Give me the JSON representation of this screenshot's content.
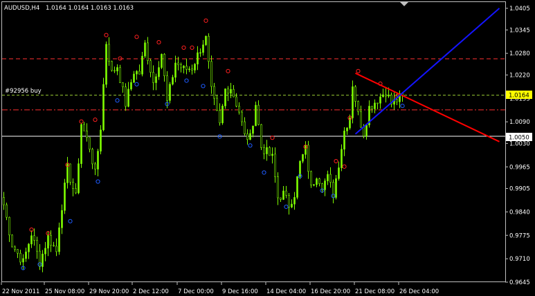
{
  "window": {
    "symbol_label": "AUDUSD,H4",
    "ohlc_label": "1.0164 1.0164 1.0163 1.0163"
  },
  "order": {
    "label": "#92956 buy",
    "price": 1.0125
  },
  "colors": {
    "background": "#000000",
    "frame": "#c0c0c0",
    "bull_candle": "#7fff00",
    "bear_candle": "#7fff00",
    "fractal_up": "#ff2020",
    "fractal_down": "#1e5cff",
    "order_line": "#9acd32",
    "sl_line": "#ff3030",
    "resistance_line": "#ff0000",
    "support_line": "#1414ff",
    "bid_badge": "#ffff00",
    "stop_badge": "#ffffff"
  },
  "chart_data": {
    "type": "candlestick",
    "title": "AUDUSD,H4",
    "y_ticks": [
      "1.0405",
      "1.0345",
      "1.0280",
      "1.0220",
      "1.0155",
      "1.0090",
      "1.0030",
      "0.9965",
      "0.9905",
      "0.9840",
      "0.9775",
      "0.9710",
      "0.9645"
    ],
    "ylim": [
      0.9645,
      1.0405
    ],
    "x_ticks": [
      "22 Nov 2011",
      "25 Nov 08:00",
      "29 Nov 20:00",
      "2 Dec 12:00",
      "7 Dec 00:00",
      "9 Dec 16:00",
      "14 Dec 04:00",
      "16 Dec 20:00",
      "21 Dec 08:00",
      "26 Dec 04:00"
    ],
    "current_price": {
      "label": "1.0164",
      "value": 1.0164
    },
    "stop_price": {
      "label": "1.0050",
      "value": 1.005
    },
    "horizontal_lines": [
      {
        "kind": "order",
        "value": 1.0164,
        "style": "dashed"
      },
      {
        "kind": "stop",
        "value": 1.005,
        "style": "solid"
      },
      {
        "kind": "level",
        "value": 1.0265,
        "style": "dashed"
      },
      {
        "kind": "level",
        "value": 1.0123,
        "style": "dash-dot"
      }
    ],
    "trendlines": [
      {
        "name": "resistance",
        "from": {
          "bar": 127,
          "price": 1.0225
        },
        "to": {
          "bar": 179,
          "price": 1.0035
        }
      },
      {
        "name": "support",
        "from": {
          "bar": 127,
          "price": 1.0056
        },
        "to": {
          "bar": 179,
          "price": 1.0405
        }
      }
    ],
    "anchors": [
      [
        0,
        0.986
      ],
      [
        3,
        0.975
      ],
      [
        7,
        0.97
      ],
      [
        10,
        0.978
      ],
      [
        13,
        0.97
      ],
      [
        16,
        0.977
      ],
      [
        19,
        0.973
      ],
      [
        20,
        0.9805
      ],
      [
        23,
        0.996
      ],
      [
        26,
        0.988
      ],
      [
        28,
        1.0085
      ],
      [
        31,
        1.002
      ],
      [
        33,
        0.9945
      ],
      [
        35,
        1.0075
      ],
      [
        37,
        1.031
      ],
      [
        39,
        1.0225
      ],
      [
        41,
        1.0245
      ],
      [
        44,
        1.014
      ],
      [
        47,
        1.023
      ],
      [
        49,
        1.0225
      ],
      [
        51,
        1.0305
      ],
      [
        54,
        1.02
      ],
      [
        57,
        1.028
      ],
      [
        59,
        1.0145
      ],
      [
        62,
        1.0255
      ],
      [
        65,
        1.0235
      ],
      [
        68,
        1.024
      ],
      [
        72,
        1.031
      ],
      [
        73,
        1.032
      ],
      [
        75,
        1.0175
      ],
      [
        78,
        1.008
      ],
      [
        80,
        1.018
      ],
      [
        82,
        1.0185
      ],
      [
        85,
        1.012
      ],
      [
        87,
        1.005
      ],
      [
        89,
        1.0045
      ],
      [
        91,
        1.014
      ],
      [
        93,
        1.002
      ],
      [
        95,
        1.0005
      ],
      [
        97,
        0.999
      ],
      [
        99,
        0.988
      ],
      [
        101,
        0.989
      ],
      [
        103,
        0.986
      ],
      [
        105,
        0.989
      ],
      [
        107,
        0.9975
      ],
      [
        109,
        1.0015
      ],
      [
        111,
        0.9905
      ],
      [
        113,
        0.9945
      ],
      [
        115,
        0.9915
      ],
      [
        117,
        0.9935
      ],
      [
        119,
        0.989
      ],
      [
        121,
        0.9975
      ],
      [
        123,
        1.0065
      ],
      [
        125,
        1.0105
      ],
      [
        126,
        1.0195
      ],
      [
        128,
        1.011
      ],
      [
        130,
        1.006
      ],
      [
        132,
        1.013
      ],
      [
        134,
        1.0145
      ],
      [
        136,
        1.016
      ],
      [
        138,
        1.0175
      ],
      [
        140,
        1.014
      ],
      [
        142,
        1.015
      ],
      [
        144,
        1.0163
      ]
    ],
    "fractals_up": [
      [
        10,
        0.9785
      ],
      [
        16,
        0.9775
      ],
      [
        23,
        0.9965
      ],
      [
        28,
        1.0085
      ],
      [
        33,
        1.009
      ],
      [
        37,
        1.0325
      ],
      [
        42,
        1.026
      ],
      [
        48,
        1.032
      ],
      [
        56,
        1.0305
      ],
      [
        65,
        1.029
      ],
      [
        68,
        1.029
      ],
      [
        73,
        1.0365
      ],
      [
        81,
        1.0225
      ],
      [
        97,
        1.004
      ],
      [
        109,
        1.0015
      ],
      [
        120,
        0.9975
      ],
      [
        123,
        0.996
      ],
      [
        125,
        1.0095
      ],
      [
        128,
        1.0225
      ],
      [
        136,
        1.019
      ],
      [
        142,
        1.0155
      ]
    ],
    "fractals_down": [
      [
        7,
        0.969
      ],
      [
        13,
        0.97
      ],
      [
        24,
        0.982
      ],
      [
        34,
        0.993
      ],
      [
        41,
        1.0155
      ],
      [
        48,
        1.02
      ],
      [
        59,
        1.0145
      ],
      [
        66,
        1.021
      ],
      [
        72,
        1.0195
      ],
      [
        78,
        1.0055
      ],
      [
        89,
        1.003
      ],
      [
        94,
        0.9955
      ],
      [
        102,
        0.986
      ],
      [
        107,
        0.9945
      ],
      [
        115,
        0.9905
      ],
      [
        119,
        0.989
      ],
      [
        144,
        1.014
      ]
    ]
  }
}
